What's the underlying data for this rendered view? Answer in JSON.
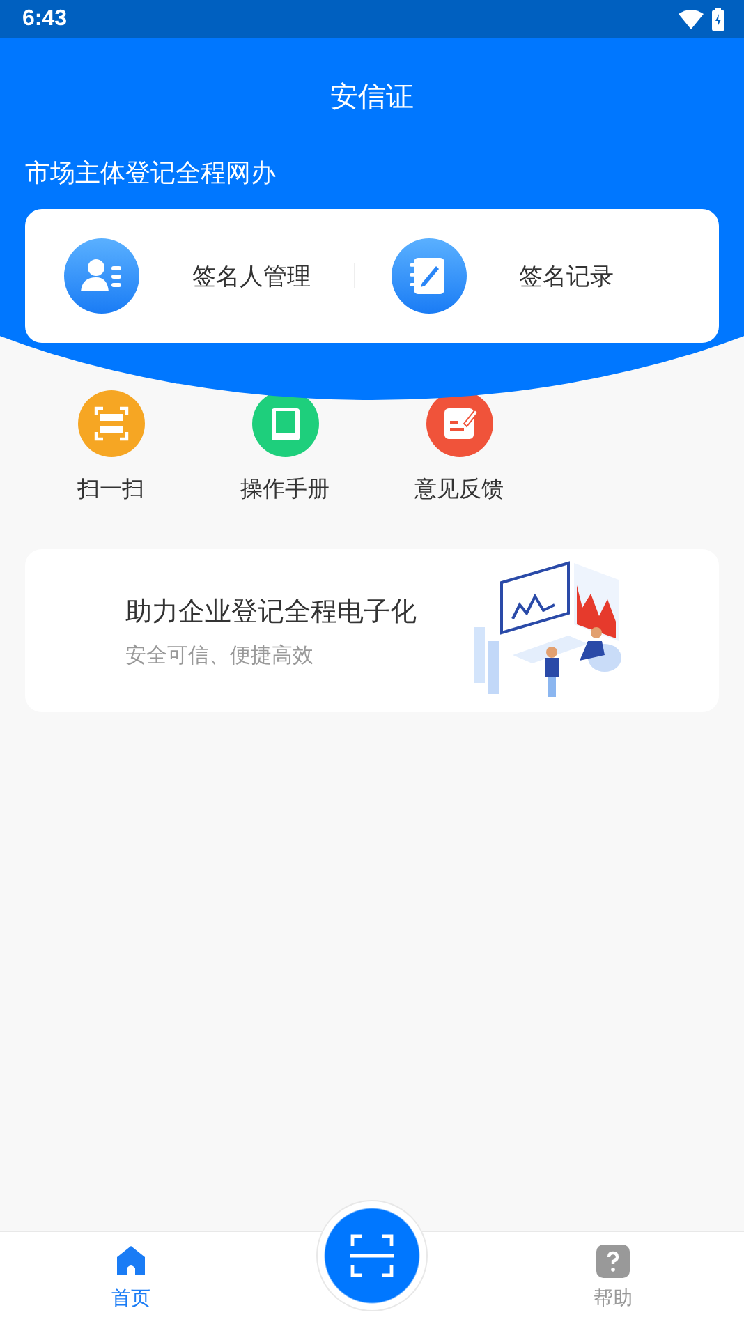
{
  "status_bar": {
    "time": "6:43"
  },
  "header": {
    "title": "安信证",
    "subtitle": "市场主体登记全程网办"
  },
  "main_card": [
    {
      "label": "签名人管理",
      "kind": "person"
    },
    {
      "label": "签名记录",
      "kind": "notebook"
    }
  ],
  "quick_actions": [
    {
      "label": "扫一扫",
      "kind": "scan",
      "color": "#f6a623"
    },
    {
      "label": "操作手册",
      "kind": "book",
      "color": "#1ecf7c"
    },
    {
      "label": "意见反馈",
      "kind": "feedback",
      "color": "#f0533a"
    }
  ],
  "banner": {
    "title": "助力企业登记全程电子化",
    "subtitle": "安全可信、便捷高效"
  },
  "bottom_nav": [
    {
      "label": "首页",
      "kind": "home",
      "selected": true
    },
    {
      "label": "帮助",
      "kind": "help",
      "selected": false
    }
  ]
}
